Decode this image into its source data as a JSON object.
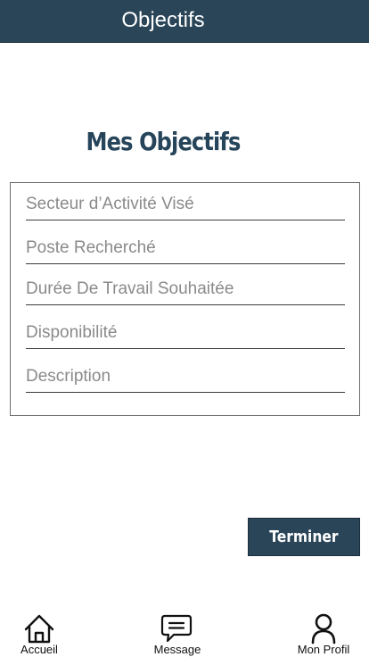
{
  "header": {
    "title": "Objectifs"
  },
  "page": {
    "heading": "Mes Objectifs"
  },
  "form": {
    "fields": [
      {
        "placeholder": "Secteur d’Activité Visé"
      },
      {
        "placeholder": "Poste Recherché"
      },
      {
        "placeholder": "Durée De Travail Souhaitée"
      },
      {
        "placeholder": "Disponibilité"
      },
      {
        "placeholder": "Description"
      }
    ]
  },
  "actions": {
    "finish_label": "Terminer"
  },
  "tabbar": {
    "items": [
      {
        "label": "Accueil",
        "icon": "home-icon"
      },
      {
        "label": "Message",
        "icon": "message-icon"
      },
      {
        "label": "Mon Profil",
        "icon": "profile-icon"
      }
    ]
  },
  "colors": {
    "primary": "#2a4558",
    "heading": "#26445a",
    "placeholder": "#8a8a8a"
  }
}
